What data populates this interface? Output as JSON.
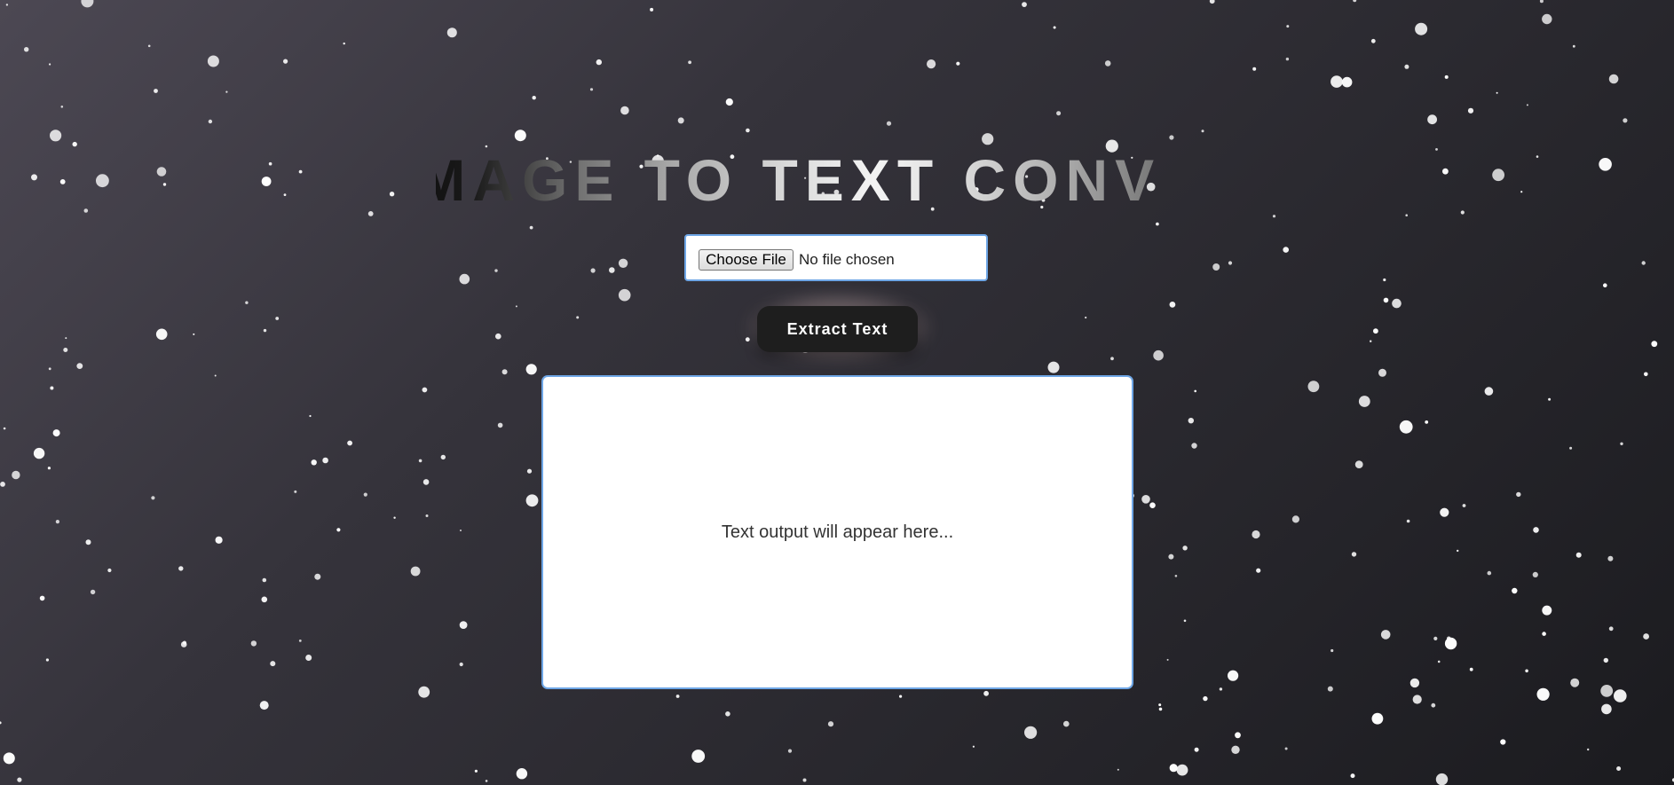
{
  "title": "IMAGE TO TEXT CONVERTER",
  "file_input": {
    "button_label": "Choose File",
    "status": "No file chosen"
  },
  "extract_button": {
    "label": "Extract Text"
  },
  "output": {
    "placeholder": "Text output will appear here..."
  },
  "colors": {
    "background_top": "#4c4853",
    "background_bottom": "#1b1b1f",
    "accent_border": "#6ea6e6",
    "button_bg": "#1e1e1e",
    "button_glow": "#e8c8c6",
    "snow": "#ffffff"
  }
}
